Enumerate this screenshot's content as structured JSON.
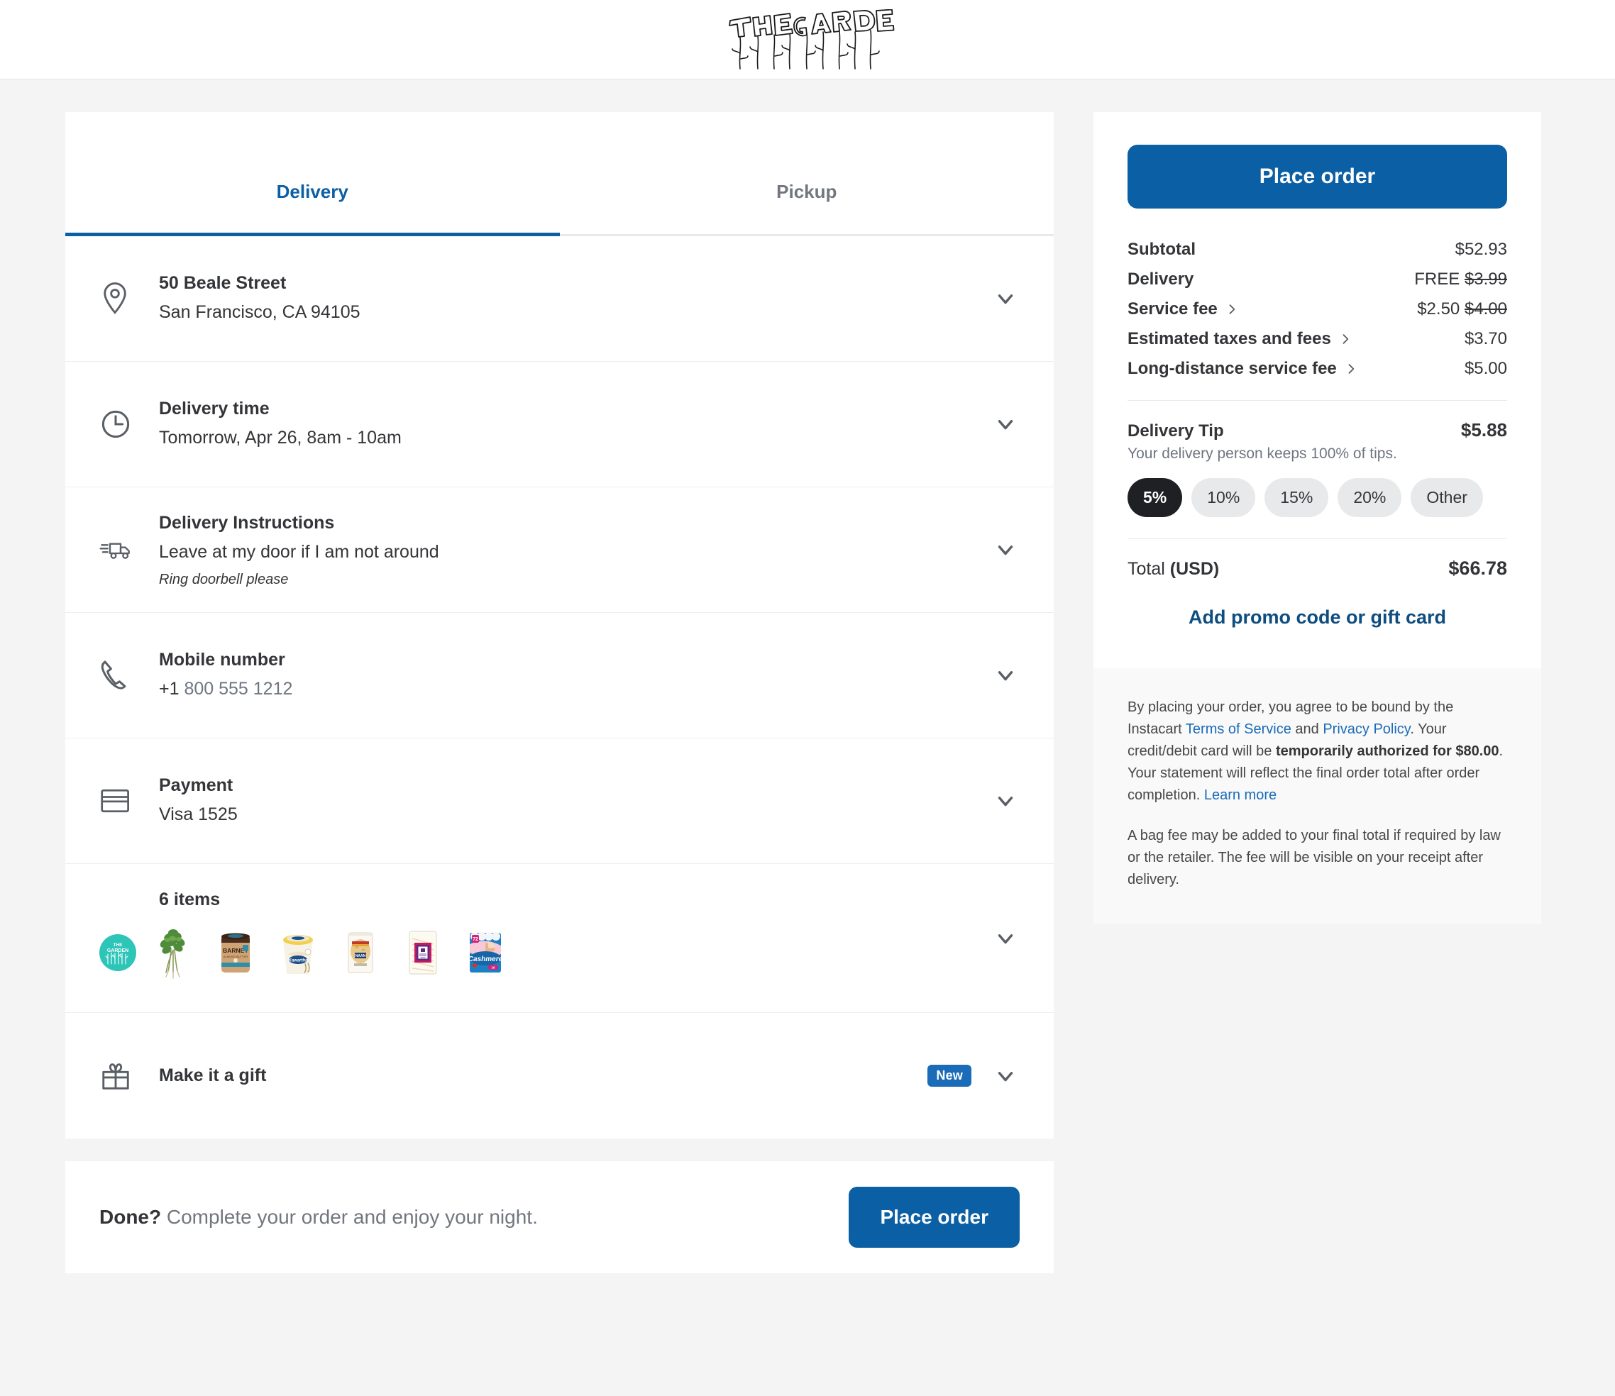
{
  "header": {
    "logo_text": "THE GARDEN",
    "logo_icon": "garden-flowers-logo"
  },
  "tabs": [
    {
      "label": "Delivery",
      "active": true
    },
    {
      "label": "Pickup",
      "active": false
    }
  ],
  "checkout_rows": {
    "address": {
      "icon": "location-pin-icon",
      "title": "50 Beale Street",
      "subtitle": "San Francisco, CA 94105"
    },
    "delivery_time": {
      "icon": "clock-icon",
      "title": "Delivery time",
      "subtitle": "Tomorrow, Apr 26, 8am - 10am"
    },
    "instructions": {
      "icon": "delivery-truck-icon",
      "title": "Delivery Instructions",
      "subtitle": "Leave at my door if I am not around",
      "note": "Ring doorbell please"
    },
    "mobile": {
      "icon": "phone-icon",
      "title": "Mobile number",
      "prefix": "+1",
      "number": "800 555 1212"
    },
    "payment": {
      "icon": "credit-card-icon",
      "title": "Payment",
      "subtitle": "Visa 1525"
    },
    "items": {
      "count_label": "6 items",
      "store_avatar": "the-garden-store-avatar",
      "thumbnails": [
        "fresh-herbs-bunch",
        "barney-almond-butter-jar",
        "kawartha-vanilla-ice-cream-tub",
        "naan-flatbread-pouch",
        "shredded-cheese-bag",
        "cashmere-toilet-paper-pack"
      ]
    },
    "gift": {
      "icon": "gift-icon",
      "title": "Make it a gift",
      "badge": "New"
    }
  },
  "cta_bar": {
    "prompt_bold": "Done?",
    "prompt_rest": "Complete your order and enjoy your night.",
    "button_label": "Place order"
  },
  "summary": {
    "place_order_label": "Place order",
    "lines": [
      {
        "label": "Subtotal",
        "value": "$52.93",
        "has_chevron": false,
        "struck": ""
      },
      {
        "label": "Delivery",
        "value": "FREE",
        "has_chevron": false,
        "struck": "$3.99"
      },
      {
        "label": "Service fee",
        "value": "$2.50",
        "has_chevron": true,
        "struck": "$4.00"
      },
      {
        "label": "Estimated taxes and fees",
        "value": "$3.70",
        "has_chevron": true,
        "struck": ""
      },
      {
        "label": "Long-distance service fee",
        "value": "$5.00",
        "has_chevron": true,
        "struck": ""
      }
    ],
    "tip": {
      "title": "Delivery Tip",
      "amount": "$5.88",
      "subtitle": "Your delivery person keeps 100% of tips.",
      "options": [
        {
          "label": "5%",
          "selected": true
        },
        {
          "label": "10%",
          "selected": false
        },
        {
          "label": "15%",
          "selected": false
        },
        {
          "label": "20%",
          "selected": false
        },
        {
          "label": "Other",
          "selected": false
        }
      ]
    },
    "total": {
      "label_prefix": "Total ",
      "label_currency": "(USD)",
      "value": "$66.78"
    },
    "promo_label": "Add promo code or gift card"
  },
  "legal": {
    "p1_part1": "By placing your order, you agree to be bound by the Instacart ",
    "p1_link1": "Terms of Service",
    "p1_part2": " and ",
    "p1_link2": "Privacy Policy",
    "p1_part3": ". Your credit/debit card will be ",
    "p1_bold": "temporarily authorized for $80.00",
    "p1_part4": ". Your statement will reflect the final order total after order completion. ",
    "p1_link3": "Learn more",
    "p2": "A bag fee may be added to your final total if required by law or the retailer. The fee will be visible on your receipt after delivery."
  },
  "colors": {
    "brand_blue": "#0b5fa5",
    "link_blue": "#1a6bb8",
    "promo_blue": "#0e4d80",
    "store_teal": "#2cc5b8",
    "chip_selected": "#1f2023",
    "page_bg": "#f4f4f4"
  }
}
